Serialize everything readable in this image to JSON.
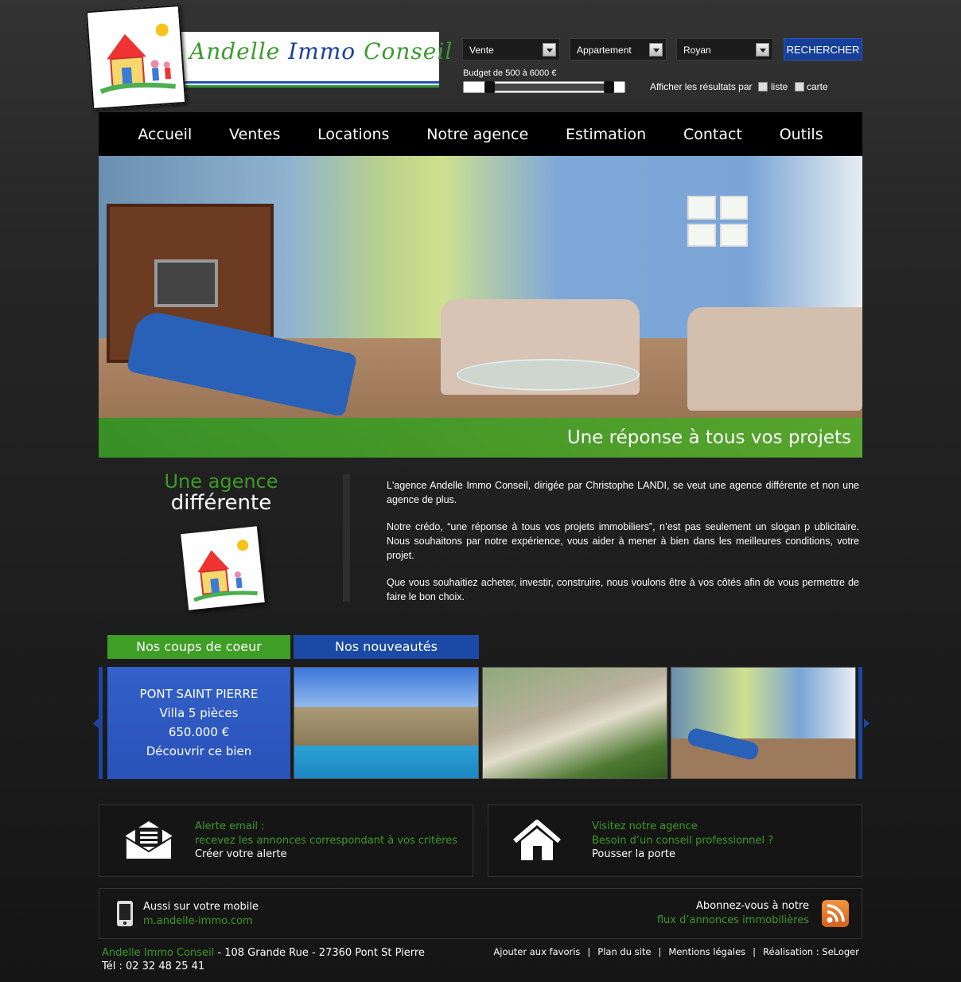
{
  "header": {
    "logo_text_green1": "Andelle",
    "logo_text_blue": "Immo",
    "logo_text_green2": "Conseil",
    "search": {
      "transaction": "Vente",
      "property_type": "Appartement",
      "city": "Royan",
      "button_label": "RECHERCHER",
      "budget_label": "Budget de 500 à 6000 €",
      "results_label": "Afficher les résultats par",
      "list_label": "liste",
      "map_label": "carte"
    }
  },
  "nav": {
    "items": [
      "Accueil",
      "Ventes",
      "Locations",
      "Notre agence",
      "Estimation",
      "Contact",
      "Outils"
    ]
  },
  "hero": {
    "caption": "Une réponse à tous vos projets"
  },
  "agency": {
    "title_green": "Une agence",
    "title_white": "différente",
    "paragraphs": [
      "L'agence Andelle Immo Conseil, dirigée par Christophe LANDI, se veut une agence différente et non une agence de plus.",
      "Notre crédo, “une réponse à tous vos projets immobiliers”, n’est pas seulement un slogan p ublicitaire. Nous souhaitons par notre expérience, vous aider à mener à bien dans les meilleures conditions, votre projet.",
      "Que vous souhaitiez acheter, investir, construire, nous voulons être à vos côtés afin de vous permettre de faire le bon choix."
    ]
  },
  "tabs": {
    "favorites": "Nos coups de coeur",
    "new": "Nos nouveautés"
  },
  "featured": {
    "location": "PONT SAINT PIERRE",
    "type": "Villa 5 pièces",
    "price": "650.000 €",
    "cta": "Découvrir ce bien"
  },
  "email_alert": {
    "line1": "Alerte email :",
    "line2": "recevez les annonces correspondant à vos critères",
    "link": "Créer votre alerte"
  },
  "visit": {
    "line1": "Visitez notre agence",
    "line2": "Besoin d’un conseil professionnel ?",
    "link": "Pousser la porte"
  },
  "mobile": {
    "line1": "Aussi sur votre mobile",
    "url": "m.andelle-immo.com"
  },
  "rss": {
    "line1": "Abonnez-vous à notre",
    "line2": "flux d’annonces immobilières"
  },
  "footer": {
    "company": "Andelle Immo Conseil",
    "address": " - 108 Grande Rue - 27360 Pont St Pierre",
    "phone": "Tél : 02 32 48 25 41",
    "links": [
      "Ajouter aux favoris",
      "Plan du site",
      "Mentions légales",
      "Réalisation : SeLoger"
    ]
  },
  "colors": {
    "accent_green": "#3d9a27",
    "accent_blue": "#1a4aa5",
    "background": "#262626"
  }
}
